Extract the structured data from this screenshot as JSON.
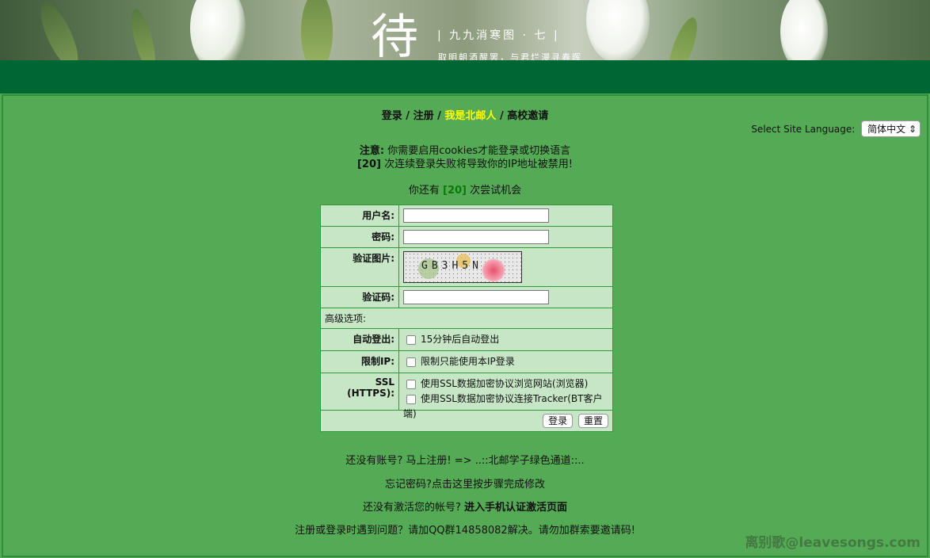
{
  "banner": {
    "logo_char": "待",
    "title": "|   九九消寒图 · 七   |",
    "subtitle": "取明朝酒醒罢，与君烂漫寻春晖"
  },
  "nav": {
    "login": "登录",
    "sep": " / ",
    "register": "注册",
    "bupt": "我是北邮人",
    "invite": "高校邀请"
  },
  "language": {
    "label": "Select Site Language:",
    "selected": "简体中文",
    "arrow": "⇕"
  },
  "notice": {
    "prefix": "注意:",
    "cookies": "你需要启用cookies才能登录或切换语言",
    "count": "[20]",
    "ban": "次连续登录失败将导致你的IP地址被禁用!"
  },
  "tries": {
    "prefix": "你还有",
    "count": "[20]",
    "suffix": "次尝试机会"
  },
  "form": {
    "username_label": "用户名:",
    "password_label": "密码:",
    "captcha_image_label": "验证图片:",
    "captcha_text": "GB3H5N",
    "captcha_label": "验证码:",
    "advanced_label": "高级选项:",
    "autologout_label": "自动登出:",
    "autologout_option": "15分钟后自动登出",
    "restrict_ip_label": "限制IP:",
    "restrict_ip_option": "限制只能使用本IP登录",
    "ssl_label": "SSL (HTTPS):",
    "ssl_browse_option": "使用SSL数据加密协议浏览网站(浏览器)",
    "ssl_tracker_option": "使用SSL数据加密协议连接Tracker(BT客户端)",
    "login_button": "登录",
    "reset_button": "重置"
  },
  "links": {
    "no_account": "还没有账号? 马上注册! => ..::北邮学子绿色通道::..",
    "forgot": "忘记密码?点击这里按步骤完成修改",
    "not_activated_prefix": "还没有激活您的帐号?",
    "not_activated_link": "进入手机认证激活页面",
    "help": "注册或登录时遇到问题？请加QQ群14858082解决。请勿加群索要邀请码!"
  },
  "watermark": "离别歌@leavesongs.com"
}
